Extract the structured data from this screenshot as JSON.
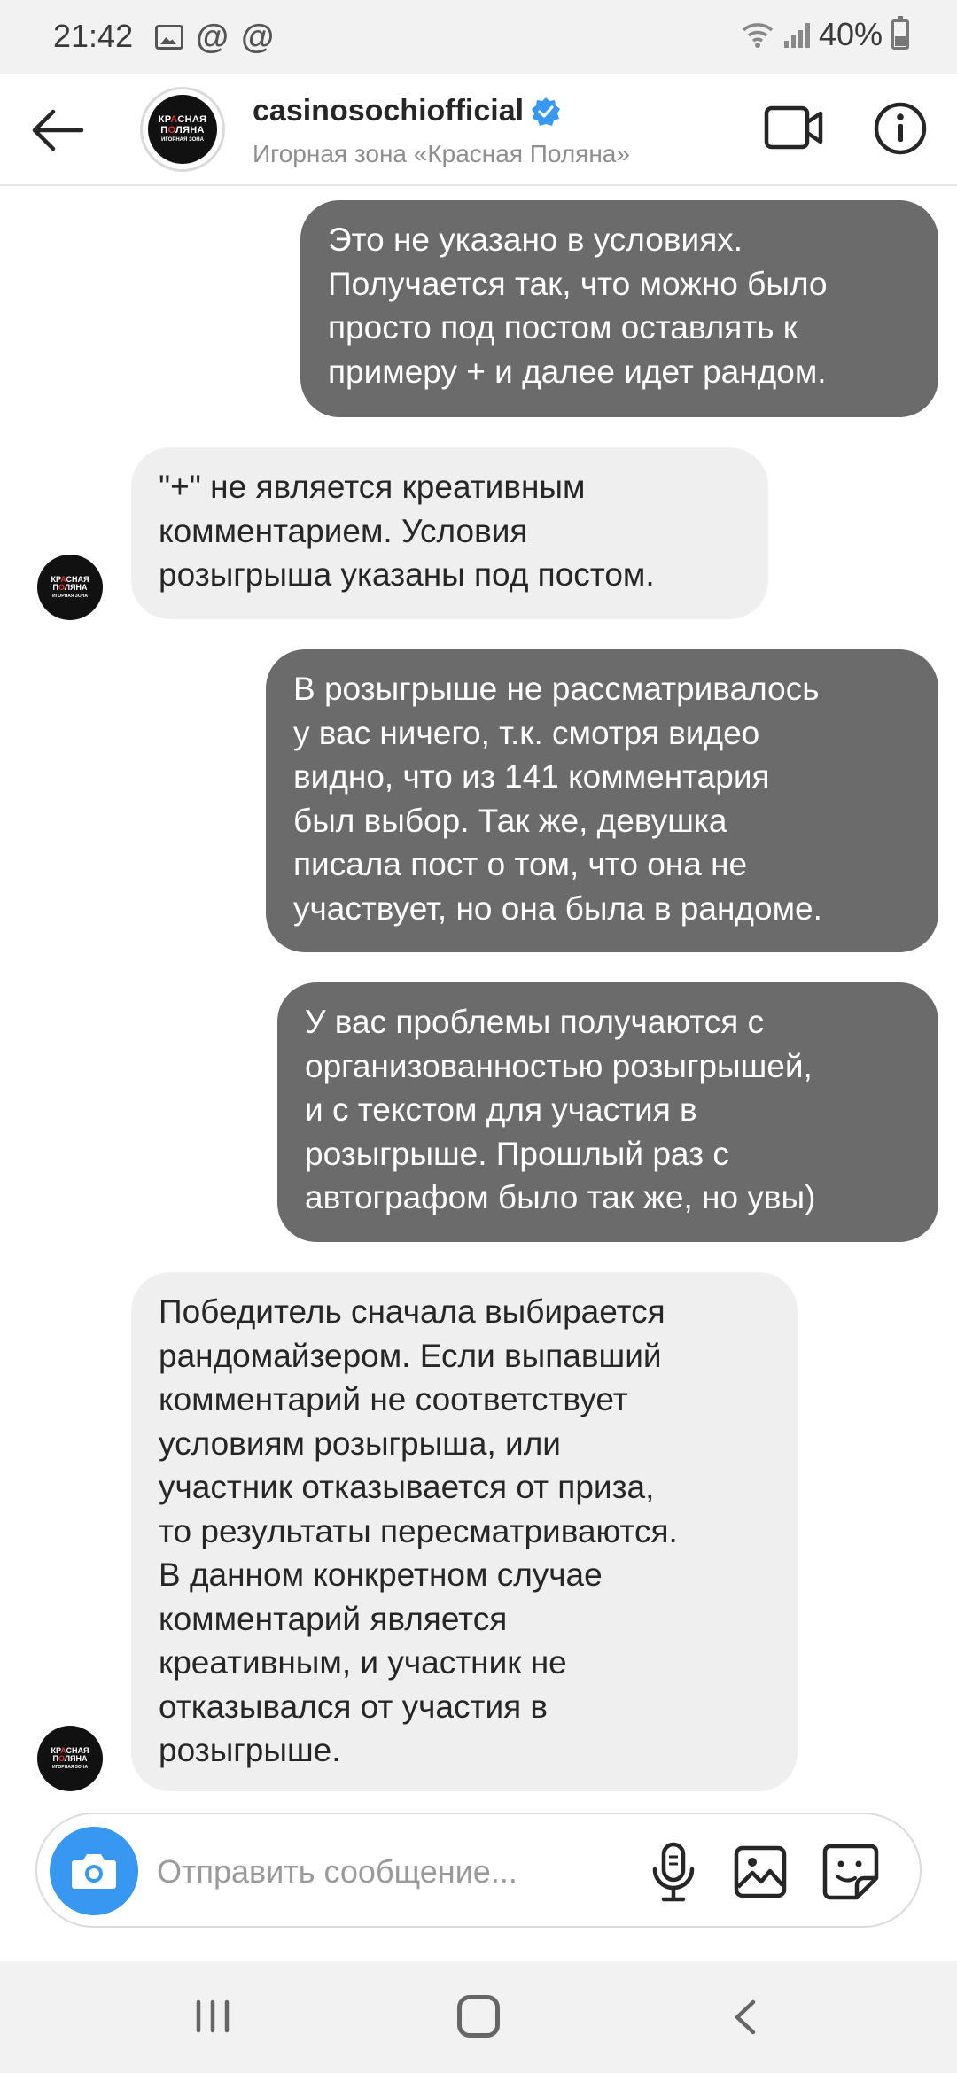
{
  "status_bar": {
    "time": "21:42",
    "battery": "40%",
    "icons_left": [
      "image-icon",
      "at-icon",
      "at-icon"
    ]
  },
  "header": {
    "username": "casinosochiofficial",
    "subtitle": "Игорная зона «Красная Поляна»",
    "verified": true,
    "avatar": {
      "line1": "КРАСНАЯ",
      "line2": "ПОЛЯНА",
      "line3": "ИГОРНАЯ ЗОНА"
    }
  },
  "messages": [
    {
      "direction": "outgoing",
      "text": "Это не указано в условиях.\nПолучается так, что можно было\nпросто под постом оставлять к\nпримеру + и далее идет рандом."
    },
    {
      "direction": "incoming",
      "text": "\"+\" не является креативным\nкомментарием. Условия\nрозыгрыша указаны под постом."
    },
    {
      "direction": "outgoing",
      "text": "В розыгрыше не рассматривалось\nу вас ничего, т.к. смотря видео\nвидно, что из 141 комментария\nбыл выбор. Так же, девушка\nписала пост о том, что она не\nучаствует, но она была в рандоме."
    },
    {
      "direction": "outgoing",
      "text": "У вас проблемы получаются с\nорганизованностью розыгрышей,\nи с текстом для участия в\nрозыгрыше. Прошлый раз с\nавтографом было так же, но увы)"
    },
    {
      "direction": "incoming",
      "text": "Победитель сначала выбирается\nрандомайзером. Если выпавший\nкомментарий не соответствует\nусловиям розыгрыша, или\nучастник отказывается от приза,\nто результаты пересматриваются.\nВ данном конкретном случае\nкомментарий является\nкреативным, и участник не\nотказывался от участия в\nрозыгрыше."
    }
  ],
  "composer": {
    "placeholder": "Отправить сообщение...",
    "value": ""
  },
  "colors": {
    "outgoing_bubble": "#6b6b6b",
    "incoming_bubble": "#efefef",
    "accent": "#3897f0"
  }
}
